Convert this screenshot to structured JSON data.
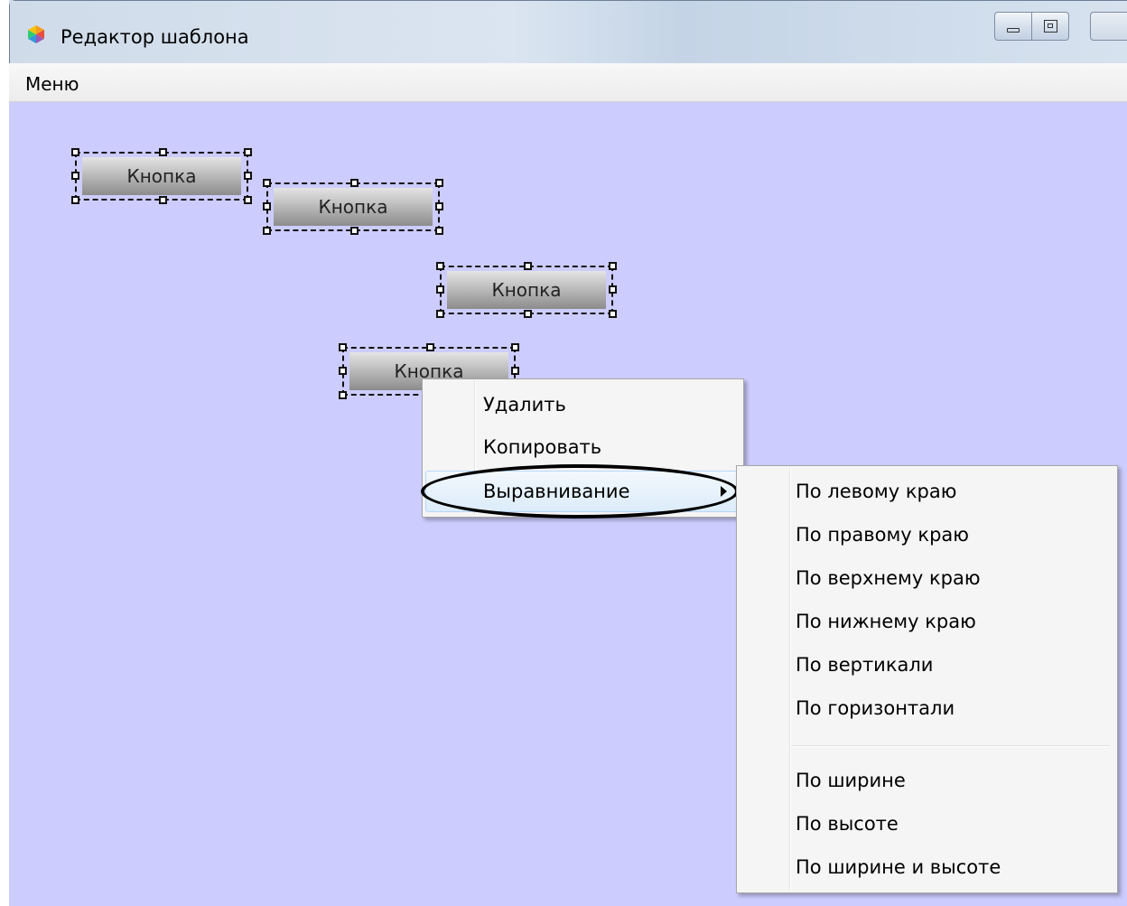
{
  "window": {
    "title": "Редактор шаблона",
    "icon": "app-logo-icon",
    "controls": [
      "minimize",
      "maximize",
      "close"
    ]
  },
  "menubar": {
    "items": [
      {
        "label": "Меню"
      }
    ]
  },
  "canvas": {
    "background": "#ccccfe",
    "buttons": [
      {
        "label": "Кнопка"
      },
      {
        "label": "Кнопка"
      },
      {
        "label": "Кнопка"
      },
      {
        "label": "Кнопка"
      }
    ]
  },
  "context_menu": {
    "items": [
      {
        "label": "Удалить"
      },
      {
        "label": "Копировать"
      },
      {
        "label": "Выравнивание",
        "submenu": true,
        "highlighted": true
      }
    ]
  },
  "align_submenu": {
    "groups": [
      [
        "По левому краю",
        "По правому краю",
        "По верхнему краю",
        "По нижнему краю",
        "По вертикали",
        "По горизонтали"
      ],
      [
        "По ширине",
        "По высоте",
        "По ширине и высоте"
      ]
    ]
  }
}
